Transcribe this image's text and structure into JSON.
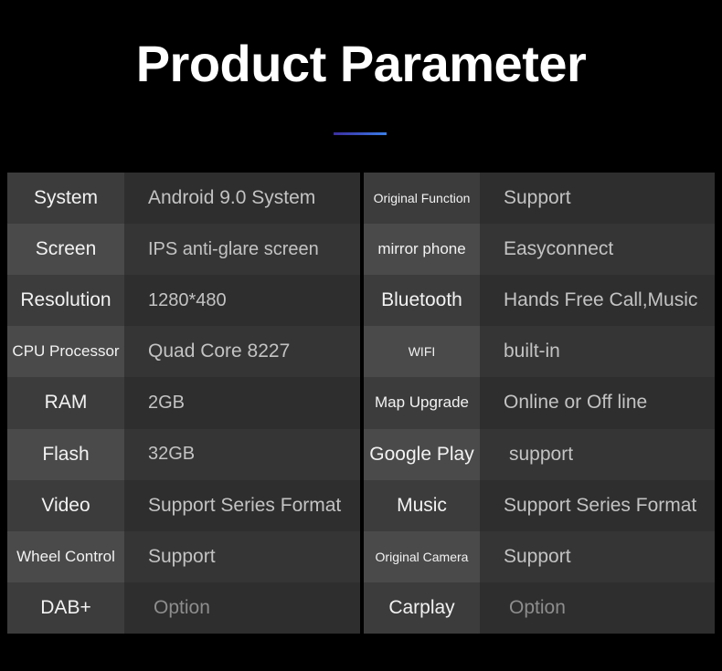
{
  "header": {
    "title": "Product Parameter",
    "divider_gradient_from": "#3b2f9e",
    "divider_gradient_to": "#3b7fe8"
  },
  "theme": {
    "background": "#000000",
    "label_cell_dark": "#3c3c3c",
    "label_cell_light": "#4a4a4a",
    "value_cell_dark": "#2e2e2e",
    "value_cell_light": "#353535",
    "label_text": "#f2f2f2",
    "value_text": "#c3c3c3",
    "value_text_dim": "#8d8d8d"
  },
  "tables": {
    "left": {
      "rows": [
        {
          "label": "System",
          "value": "Android 9.0 System"
        },
        {
          "label": "Screen",
          "value": "IPS anti-glare screen"
        },
        {
          "label": "Resolution",
          "value": "1280*480"
        },
        {
          "label": "CPU Processor",
          "value": "Quad Core 8227"
        },
        {
          "label": "RAM",
          "value": "2GB"
        },
        {
          "label": "Flash",
          "value": "32GB"
        },
        {
          "label": "Video",
          "value": "Support Series Format"
        },
        {
          "label": "Wheel Control",
          "value": "Support"
        },
        {
          "label": "DAB+",
          "value": "Option"
        }
      ]
    },
    "right": {
      "rows": [
        {
          "label": "Original Function",
          "value": "Support"
        },
        {
          "label": "mirror phone",
          "value": "Easyconnect"
        },
        {
          "label": "Bluetooth",
          "value": "Hands Free Call,Music"
        },
        {
          "label": "WIFI",
          "value": "built-in"
        },
        {
          "label": "Map Upgrade",
          "value": "Online or Off line"
        },
        {
          "label": "Google Play",
          "value": "support"
        },
        {
          "label": "Music",
          "value": "Support Series Format"
        },
        {
          "label": "Original Camera",
          "value": "Support"
        },
        {
          "label": "Carplay",
          "value": "Option"
        }
      ]
    }
  }
}
